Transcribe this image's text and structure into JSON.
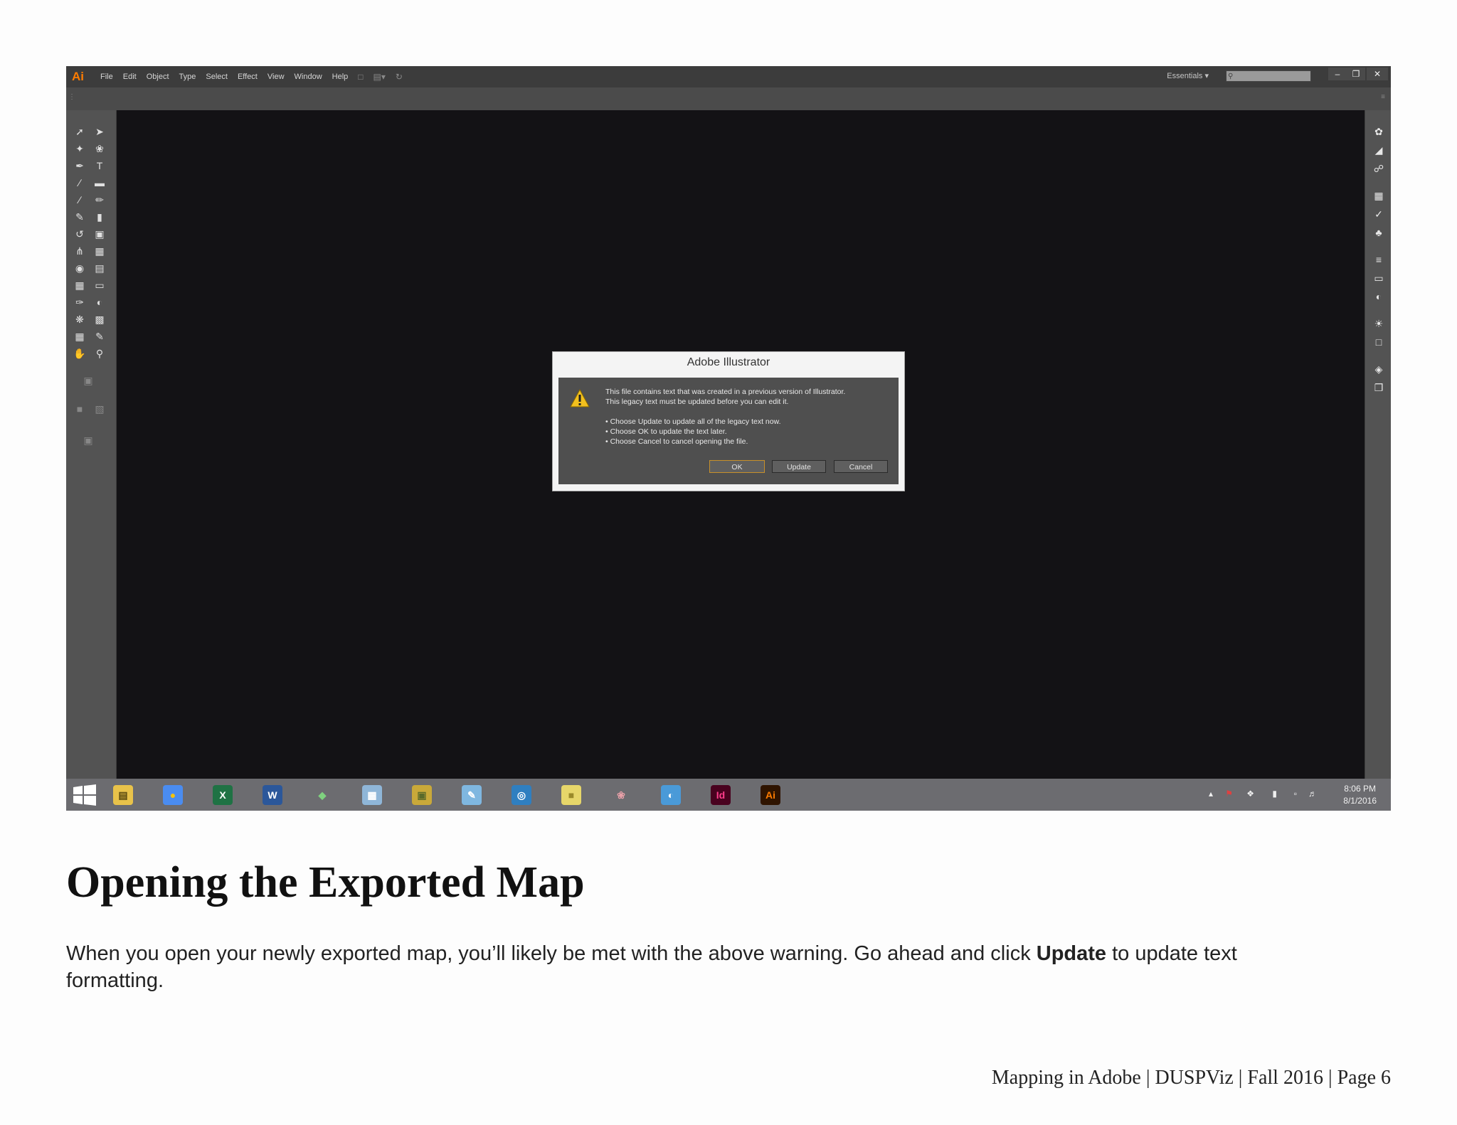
{
  "app": {
    "logo": "Ai",
    "menu": [
      "File",
      "Edit",
      "Object",
      "Type",
      "Select",
      "Effect",
      "View",
      "Window",
      "Help"
    ],
    "workspace": "Essentials",
    "search_placeholder": ""
  },
  "dialog": {
    "title": "Adobe Illustrator",
    "lines": [
      "This file contains text that was created in a previous version of Illustrator.",
      "This legacy text must be updated before you can edit it.",
      "• Choose Update to update all of the legacy text now.",
      "• Choose OK to update the text later.",
      "• Choose Cancel to cancel opening the file."
    ],
    "buttons": {
      "ok": "OK",
      "update": "Update",
      "cancel": "Cancel"
    }
  },
  "taskbar": {
    "apps": [
      {
        "name": "file-explorer",
        "glyph": "▤",
        "bg": "#e8c24a",
        "fg": "#5a4a10"
      },
      {
        "name": "chrome",
        "glyph": "●",
        "bg": "#4a8cf0",
        "fg": "#f4c20d"
      },
      {
        "name": "excel",
        "glyph": "X",
        "bg": "#1f7244",
        "fg": "#ffffff"
      },
      {
        "name": "word",
        "glyph": "W",
        "bg": "#2b579a",
        "fg": "#ffffff"
      },
      {
        "name": "app-diamond",
        "glyph": "◆",
        "bg": "#6c6c70",
        "fg": "#7fd27f"
      },
      {
        "name": "calculator",
        "glyph": "▦",
        "bg": "#8fb6d8",
        "fg": "#ffffff"
      },
      {
        "name": "app-box",
        "glyph": "▣",
        "bg": "#c9a93a",
        "fg": "#5a6a2a"
      },
      {
        "name": "app-pen",
        "glyph": "✎",
        "bg": "#7fb7e0",
        "fg": "#ffffff"
      },
      {
        "name": "magnifier",
        "glyph": "◎",
        "bg": "#2f7fc0",
        "fg": "#ffffff"
      },
      {
        "name": "sticky-notes",
        "glyph": "■",
        "bg": "#e6d66a",
        "fg": "#9a8a2a"
      },
      {
        "name": "app-brain",
        "glyph": "❀",
        "bg": "#6c6c70",
        "fg": "#e8a0a8"
      },
      {
        "name": "globe",
        "glyph": "◐",
        "bg": "#4a9ad8",
        "fg": "#ffffff"
      },
      {
        "name": "indesign",
        "glyph": "Id",
        "bg": "#49021f",
        "fg": "#ff3d8b"
      },
      {
        "name": "illustrator",
        "glyph": "Ai",
        "bg": "#2f1400",
        "fg": "#ff7c00"
      }
    ],
    "time": "8:06 PM",
    "date": "8/1/2016"
  },
  "page": {
    "heading": "Opening the Exported Map",
    "body_before": "When you open your newly exported map, you’ll likely be met with the above warning. Go ahead and click ",
    "body_bold": "Update",
    "body_after": " to update text formatting.",
    "footer": "Mapping in Adobe | DUSPViz | Fall 2016 | Page 6"
  }
}
